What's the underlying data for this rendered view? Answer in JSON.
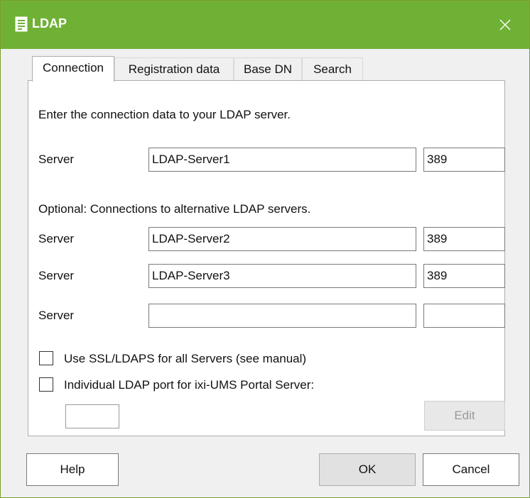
{
  "window": {
    "title": "LDAP",
    "colors": {
      "titlebar": "#6fb135",
      "titletext": "#ffffff"
    }
  },
  "icons": {
    "app": "document-list-icon",
    "close": "close-icon"
  },
  "tabs": [
    {
      "label": "Connection",
      "active": true
    },
    {
      "label": "Registration data"
    },
    {
      "label": "Base DN"
    },
    {
      "label": "Search"
    }
  ],
  "connection": {
    "intro": "Enter the connection data to your LDAP server.",
    "primary": {
      "label": "Server",
      "host": "LDAP-Server1",
      "port": "389"
    },
    "optional_heading": "Optional: Connections to alternative LDAP servers.",
    "alternatives": [
      {
        "label": "Server",
        "host": "LDAP-Server2",
        "port": "389"
      },
      {
        "label": "Server",
        "host": "LDAP-Server3",
        "port": "389"
      },
      {
        "label": "Server",
        "host": "",
        "port": ""
      }
    ],
    "ssl_checkbox": {
      "label": "Use SSL/LDAPS for all Servers (see manual)",
      "checked": false
    },
    "port_checkbox": {
      "label": "Individual LDAP port for ixi-UMS Portal Server:",
      "checked": false
    },
    "portal_port": "",
    "edit_label": "Edit"
  },
  "buttons": {
    "help": "Help",
    "ok": "OK",
    "cancel": "Cancel"
  }
}
